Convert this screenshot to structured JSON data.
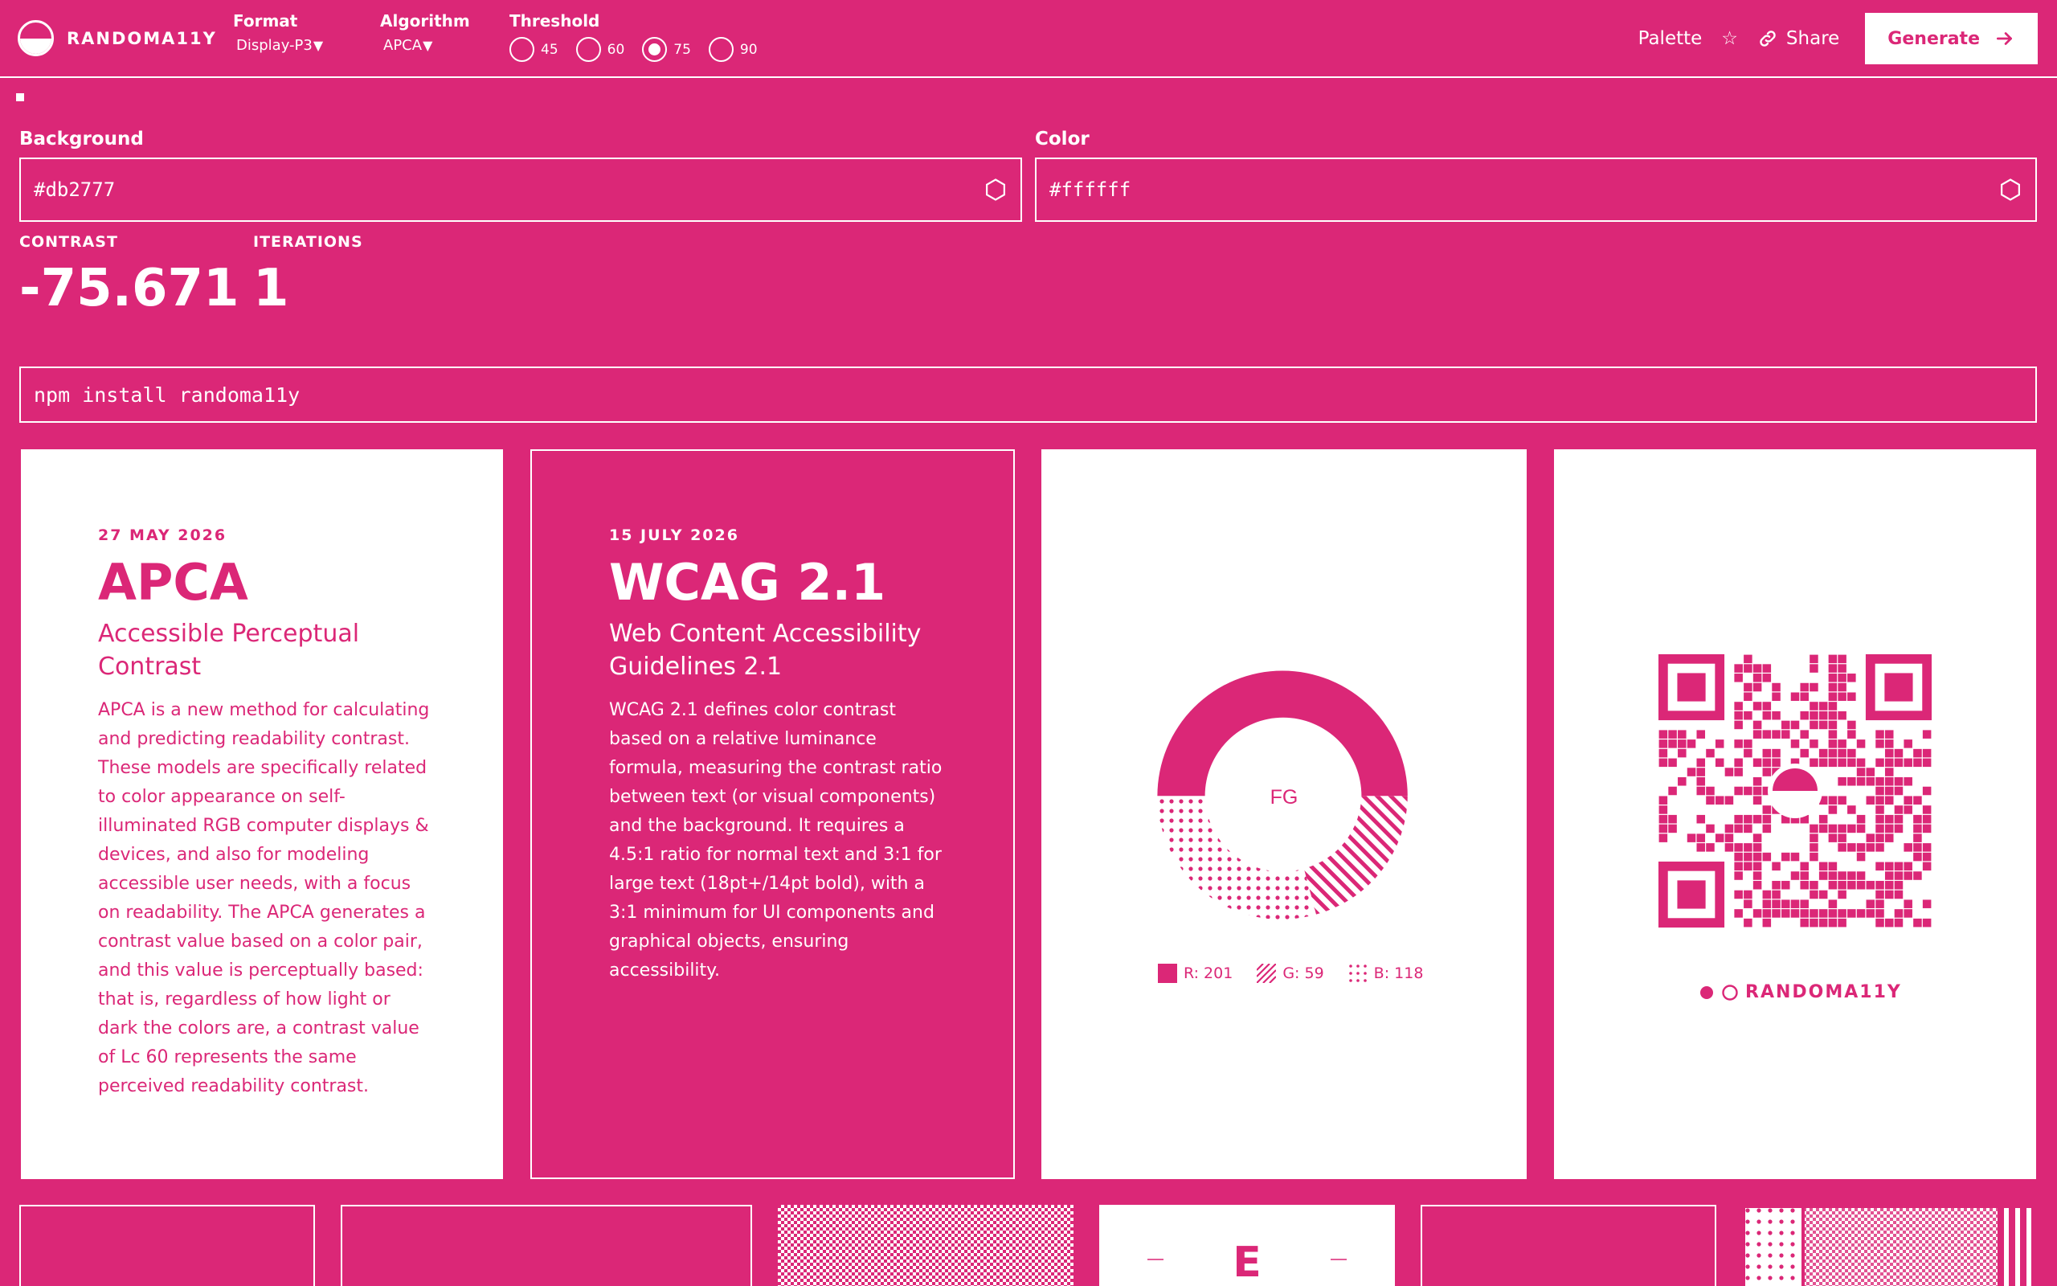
{
  "app": {
    "name": "RANDOMA11Y"
  },
  "controls": {
    "format": {
      "label": "Format",
      "value": "Display-P3"
    },
    "algorithm": {
      "label": "Algorithm",
      "value": "APCA"
    },
    "threshold": {
      "label": "Threshold",
      "options": [
        "45",
        "60",
        "75",
        "90"
      ],
      "selected": "75"
    },
    "caret": "▼"
  },
  "nav": {
    "palette": "Palette",
    "star": "☆",
    "share": "Share",
    "generate": "Generate"
  },
  "inputs": {
    "background": {
      "label": "Background",
      "value": "#db2777"
    },
    "color": {
      "label": "Color",
      "value": "#ffffff"
    }
  },
  "stats": {
    "contrast": {
      "label": "CONTRAST",
      "value": "-75.671"
    },
    "iterations": {
      "label": "ITERATIONS",
      "value": "1"
    }
  },
  "install": {
    "command": "npm install randoma11y"
  },
  "cards": {
    "apca": {
      "date": "27 MAY 2026",
      "title": "APCA",
      "subtitle": "Accessible Perceptual Contrast",
      "body": "APCA is a new method for calculating and predicting readability contrast. These models are specifically related to color appearance on self-illuminated RGB computer displays & devices, and also for modeling accessible user needs, with a focus on readability. The APCA generates a contrast value based on a color pair, and this value is perceptually based: that is, regardless of how light or dark the colors are, a contrast value of Lc 60 represents the same perceived readability contrast."
    },
    "wcag": {
      "date": "15 JULY 2026",
      "title": "WCAG 2.1",
      "subtitle": "Web Content Accessibility Guidelines 2.1",
      "body": "WCAG 2.1 defines color contrast based on a relative luminance formula, measuring the contrast ratio between text (or visual components) and the background. It requires a 4.5:1 ratio for normal text and 3:1 for large text (18pt+/14pt bold), with a 3:1 minimum for UI components and graphical objects, ensuring accessibility."
    },
    "donut": {
      "center_label": "FG",
      "legend": [
        {
          "label": "R: 201",
          "pattern": "solid",
          "value": 201
        },
        {
          "label": "G: 59",
          "pattern": "stripes",
          "value": 59
        },
        {
          "label": "B: 118",
          "pattern": "dots",
          "value": 118
        }
      ]
    },
    "qr": {
      "brand": "RANDOMA11Y"
    }
  },
  "bottom": {
    "letter": "E"
  },
  "colors": {
    "accent": "#db2777",
    "foreground": "#ffffff"
  }
}
